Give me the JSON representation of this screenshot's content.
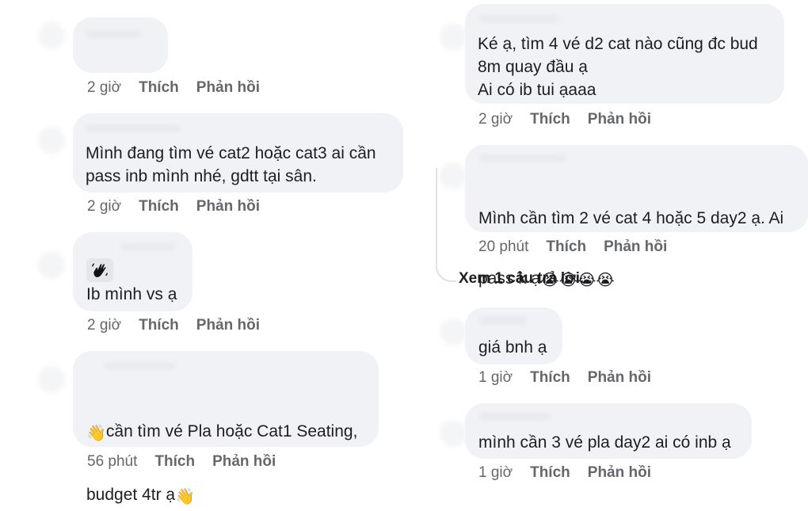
{
  "left_comments": [
    {
      "text": "",
      "time": "2 giờ",
      "like": "Thích",
      "reply": "Phản hồi"
    },
    {
      "text": "Mình đang tìm vé cat2 hoặc cat3 ai cần\npass inb mình nhé, gdtt tại sân.",
      "time": "2 giờ",
      "like": "Thích",
      "reply": "Phản hồi"
    },
    {
      "icon": "waving-hand-icon",
      "text": "Ib mình vs ạ",
      "time": "2 giờ",
      "like": "Thích",
      "reply": "Phản hồi"
    },
    {
      "line1_text": "cần tìm vé Pla hoặc Cat1 Seating,",
      "line2_text": "budget 4tr ạ",
      "emoji": "👋",
      "time": "56 phút",
      "like": "Thích",
      "reply": "Phản hồi"
    }
  ],
  "right_comments": [
    {
      "text": "Ké ạ, tìm 4 vé d2 cat nào cũng đc bud\n8m quay đầu ạ\nAi có ib tui ạaaa",
      "time": "2 giờ",
      "like": "Thích",
      "reply": "Phản hồi"
    },
    {
      "line1_text": "Mình cần tìm 2 vé cat 4 hoặc 5 day2 ạ. Ai",
      "line2_text": "pass k ạ",
      "emoji": "😭😭😭😭",
      "time": "20 phút",
      "like": "Thích",
      "reply": "Phản hồi"
    },
    {
      "text": "giá bnh ạ",
      "time": "1 giờ",
      "like": "Thích",
      "reply": "Phản hồi"
    },
    {
      "text": "mình cần 3 vé pla day2 ai có inb ạ",
      "time": "1 giờ",
      "like": "Thích",
      "reply": "Phản hồi"
    }
  ],
  "view_more_replies": "Xem 1 câu trả lời...",
  "colors": {
    "bubble": "#f0f2f5",
    "meta": "#65676b",
    "text": "#1c1e21"
  }
}
